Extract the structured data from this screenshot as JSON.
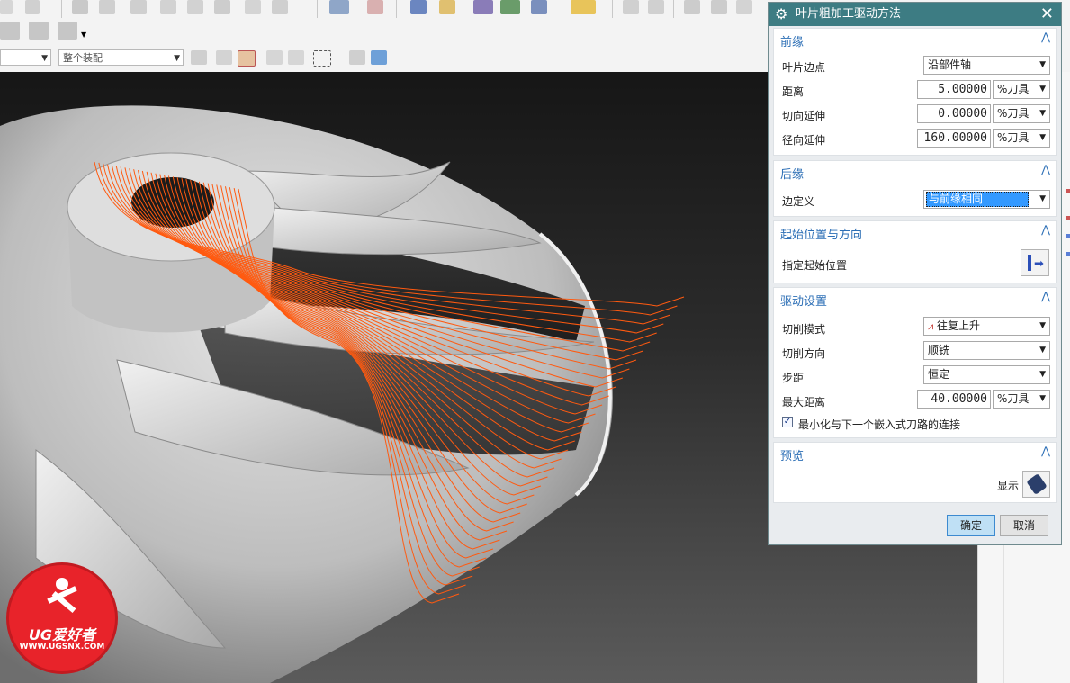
{
  "toolbar": {
    "assembly_combo": "整个装配",
    "left_combo": ""
  },
  "dialog": {
    "title": "叶片粗加工驱动方法",
    "sections": {
      "leading_edge": {
        "title": "前缘",
        "blade_edge_label": "叶片边点",
        "blade_edge_value": "沿部件轴",
        "distance_label": "距离",
        "distance_value": "5.00000",
        "distance_unit": "%刀具",
        "tangent_ext_label": "切向延伸",
        "tangent_ext_value": "0.00000",
        "tangent_ext_unit": "%刀具",
        "radial_ext_label": "径向延伸",
        "radial_ext_value": "160.00000",
        "radial_ext_unit": "%刀具"
      },
      "trailing_edge": {
        "title": "后缘",
        "edge_def_label": "边定义",
        "edge_def_value": "与前缘相同"
      },
      "start": {
        "title": "起始位置与方向",
        "start_label": "指定起始位置"
      },
      "drive": {
        "title": "驱动设置",
        "cut_pattern_label": "切削模式",
        "cut_pattern_value": "往复上升",
        "cut_dir_label": "切削方向",
        "cut_dir_value": "顺铣",
        "stepover_label": "步距",
        "stepover_value": "恒定",
        "max_dist_label": "最大距离",
        "max_dist_value": "40.00000",
        "max_dist_unit": "%刀具",
        "minimize_label": "最小化与下一个嵌入式刀路的连接",
        "minimize_checked": true
      },
      "preview": {
        "title": "预览",
        "display_label": "显示"
      }
    },
    "ok_label": "确定",
    "cancel_label": "取消"
  },
  "watermark": {
    "brand": "UG爱好者",
    "url": "WWW.UGSNX.COM"
  },
  "colors": {
    "title_bar": "#3d7c83",
    "section_heading": "#2d6fb6",
    "toolpath": "#ff5a10",
    "selected_item": "#3399ff",
    "ok_button": "#bfe0f5"
  }
}
